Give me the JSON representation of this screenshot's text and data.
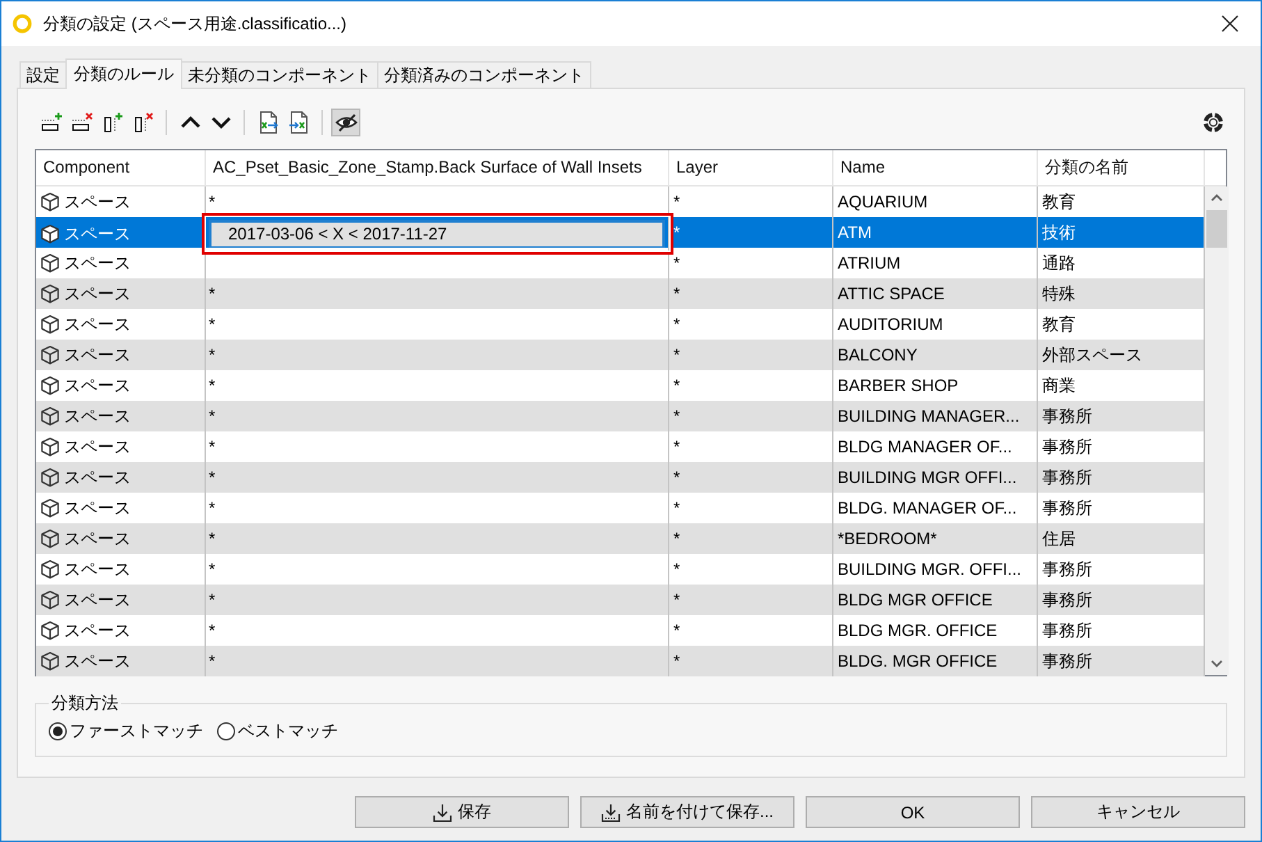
{
  "window": {
    "title": "分類の設定 (スペース用途.classificatio...)"
  },
  "tabs": [
    {
      "label": "設定",
      "selected": false
    },
    {
      "label": "分類のルール",
      "selected": true
    },
    {
      "label": "未分類のコンポーネント",
      "selected": false
    },
    {
      "label": "分類済みのコンポーネント",
      "selected": false
    }
  ],
  "toolbar": {
    "groups": [
      {
        "buttons": [
          {
            "kind": "add-row",
            "pressed": false
          },
          {
            "kind": "remove-row",
            "pressed": false
          },
          {
            "kind": "add-column",
            "pressed": false
          },
          {
            "kind": "remove-column",
            "pressed": false
          }
        ]
      },
      {
        "buttons": [
          {
            "kind": "move-up",
            "pressed": false
          },
          {
            "kind": "move-down",
            "pressed": false
          }
        ]
      },
      {
        "buttons": [
          {
            "kind": "export",
            "pressed": false
          },
          {
            "kind": "import",
            "pressed": false
          }
        ]
      },
      {
        "buttons": [
          {
            "kind": "hide",
            "pressed": true
          }
        ]
      }
    ]
  },
  "table": {
    "columns": [
      "Component",
      "AC_Pset_Basic_Zone_Stamp.Back Surface of Wall Insets",
      "Layer",
      "Name",
      "分類の名前"
    ],
    "rows": [
      {
        "component": "スペース",
        "condition": "*",
        "layer": "*",
        "name": "AQUARIUM",
        "class": "教育",
        "selected": false,
        "editing": false,
        "outlined": false
      },
      {
        "component": "スペース",
        "condition": "2017-03-06 < X < 2017-11-27",
        "layer": "*",
        "name": "ATM",
        "class": "技術",
        "selected": true,
        "editing": true,
        "outlined": true
      },
      {
        "component": "スペース",
        "layer": "*",
        "name": "ATRIUM",
        "class": "通路",
        "selected": false,
        "editing": false,
        "outlined": false
      },
      {
        "component": "スペース",
        "condition": "*",
        "layer": "*",
        "name": "ATTIC SPACE",
        "class": "特殊",
        "selected": false,
        "editing": false,
        "outlined": false
      },
      {
        "component": "スペース",
        "condition": "*",
        "layer": "*",
        "name": "AUDITORIUM",
        "class": "教育",
        "selected": false,
        "editing": false,
        "outlined": false
      },
      {
        "component": "スペース",
        "condition": "*",
        "layer": "*",
        "name": "BALCONY",
        "class": "外部スペース",
        "selected": false,
        "editing": false,
        "outlined": false
      },
      {
        "component": "スペース",
        "condition": "*",
        "layer": "*",
        "name": "BARBER SHOP",
        "class": "商業",
        "selected": false,
        "editing": false,
        "outlined": false
      },
      {
        "component": "スペース",
        "condition": "*",
        "layer": "*",
        "name": "BUILDING MANAGER...",
        "class": "事務所",
        "selected": false,
        "editing": false,
        "outlined": false
      },
      {
        "component": "スペース",
        "condition": "*",
        "layer": "*",
        "name": "BLDG MANAGER OF...",
        "class": "事務所",
        "selected": false,
        "editing": false,
        "outlined": false
      },
      {
        "component": "スペース",
        "condition": "*",
        "layer": "*",
        "name": "BUILDING MGR OFFI...",
        "class": "事務所",
        "selected": false,
        "editing": false,
        "outlined": false
      },
      {
        "component": "スペース",
        "condition": "*",
        "layer": "*",
        "name": "BLDG. MANAGER OF...",
        "class": "事務所",
        "selected": false,
        "editing": false,
        "outlined": false
      },
      {
        "component": "スペース",
        "condition": "*",
        "layer": "*",
        "name": "*BEDROOM*",
        "class": "住居",
        "selected": false,
        "editing": false,
        "outlined": false
      },
      {
        "component": "スペース",
        "condition": "*",
        "layer": "*",
        "name": "BUILDING MGR. OFFI...",
        "class": "事務所",
        "selected": false,
        "editing": false,
        "outlined": false
      },
      {
        "component": "スペース",
        "condition": "*",
        "layer": "*",
        "name": "BLDG MGR OFFICE",
        "class": "事務所",
        "selected": false,
        "editing": false,
        "outlined": false
      },
      {
        "component": "スペース",
        "condition": "*",
        "layer": "*",
        "name": "BLDG MGR. OFFICE",
        "class": "事務所",
        "selected": false,
        "editing": false,
        "outlined": false
      },
      {
        "component": "スペース",
        "condition": "*",
        "layer": "*",
        "name": "BLDG. MGR OFFICE",
        "class": "事務所",
        "selected": false,
        "editing": false,
        "outlined": false
      }
    ]
  },
  "classification_method": {
    "title": "分類方法",
    "options": [
      {
        "label": "ファーストマッチ",
        "selected": true
      },
      {
        "label": "ベストマッチ",
        "selected": false
      }
    ]
  },
  "buttons": [
    {
      "label": "保存",
      "kind": "save"
    },
    {
      "label": "名前を付けて保存...",
      "kind": "save-as"
    },
    {
      "label": "OK",
      "kind": "ok"
    },
    {
      "label": "キャンセル",
      "kind": "cancel"
    }
  ]
}
